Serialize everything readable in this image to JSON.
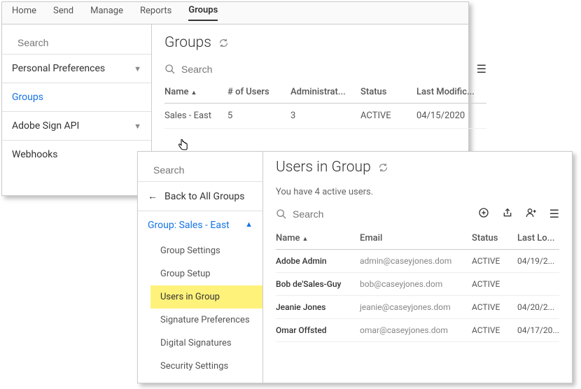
{
  "topTabs": [
    "Home",
    "Send",
    "Manage",
    "Reports",
    "Groups"
  ],
  "activeTopTab": "Groups",
  "sidebar1": {
    "searchPlaceholder": "Search",
    "items": [
      {
        "label": "Personal Preferences",
        "chevron": true
      },
      {
        "label": "Groups",
        "blue": true
      },
      {
        "label": "Adobe Sign API",
        "chevron": true
      },
      {
        "label": "Webhooks"
      }
    ]
  },
  "main1": {
    "title": "Groups",
    "searchPlaceholder": "Search",
    "cols": [
      "Name",
      "# of Users",
      "Administrat...",
      "Status",
      "Last Modific..."
    ],
    "rows": [
      {
        "name": "Sales - East",
        "users": "5",
        "admins": "3",
        "status": "ACTIVE",
        "mod": "04/15/2020"
      }
    ]
  },
  "sidebar2": {
    "searchPlaceholder": "Search",
    "backLabel": "Back to All Groups",
    "groupLabel": "Group: Sales - East",
    "subitems": [
      "Group Settings",
      "Group Setup",
      "Users in Group",
      "Signature Preferences",
      "Digital Signatures",
      "Security Settings"
    ],
    "highlighted": "Users in Group"
  },
  "main2": {
    "title": "Users in Group",
    "subMsg": "You have 4 active users.",
    "searchPlaceholder": "Search",
    "cols": [
      "Name",
      "Email",
      "Status",
      "Last Lo..."
    ],
    "rows": [
      {
        "name": "Adobe Admin",
        "email": "admin@caseyjones.dom",
        "status": "ACTIVE",
        "last": "04/19/2..."
      },
      {
        "name": "Bob de'Sales-Guy",
        "email": "bob@caseyjones.dom",
        "status": "ACTIVE",
        "last": ""
      },
      {
        "name": "Jeanie Jones",
        "email": "jeanie@caseyjones.dom",
        "status": "ACTIVE",
        "last": "04/20/2..."
      },
      {
        "name": "Omar Offsted",
        "email": "omar@caseyjones.dom",
        "status": "ACTIVE",
        "last": "04/17/20..."
      }
    ]
  }
}
